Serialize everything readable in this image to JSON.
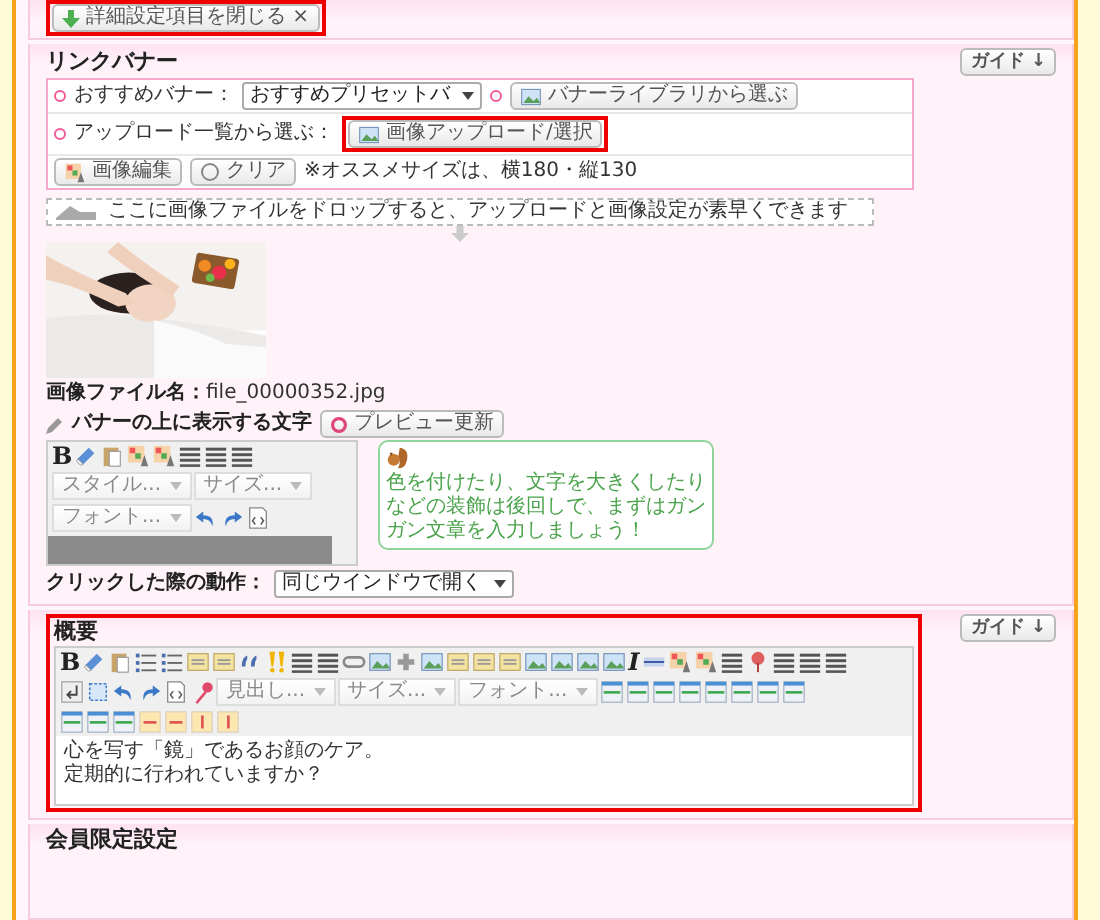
{
  "top_bar": {
    "close_button": "詳細設定項目を閉じる ×"
  },
  "link_banner": {
    "title": "リンクバナー",
    "guide_button": "ガイド ↓",
    "recommended_label": "おすすめバナー：",
    "recommended_select": "おすすめプリセットバ",
    "library_button": "バナーライブラリから選ぶ",
    "upload_label": "アップロード一覧から選ぶ：",
    "upload_button": "画像アップロード/選択",
    "edit_button": "画像編集",
    "clear_button": "クリア",
    "size_note": "※オススメサイズは、横180・縦130",
    "drop_zone": "ここに画像ファイルをドロップすると、アップロードと画像設定が素早くできます",
    "file_label": "画像ファイル名：",
    "file_name": "file_00000352.jpg",
    "overlay_label": "バナーの上に表示する文字",
    "preview_button": "プレビュー更新",
    "editor": {
      "bold_button": "B",
      "style_select": "スタイル...",
      "size_select": "サイズ...",
      "font_select": "フォント..."
    },
    "tip": "色を付けたり、文字を大きくしたりなどの装飾は後回しで、まずはガンガン文章を入力しましょう！",
    "click_label": "クリックした際の動作：",
    "click_select": "同じウインドウで開く"
  },
  "summary": {
    "title": "概要",
    "guide_button": "ガイド ↓",
    "editor": {
      "bold_button": "B",
      "italic_button": "I",
      "heading_select": "見出し...",
      "size_select": "サイズ...",
      "font_select": "フォント...",
      "text": [
        "心を写す「鏡」であるお顔のケア。",
        "定期的に行われていますか？"
      ]
    }
  },
  "member_settings": {
    "title": "会員限定設定"
  }
}
